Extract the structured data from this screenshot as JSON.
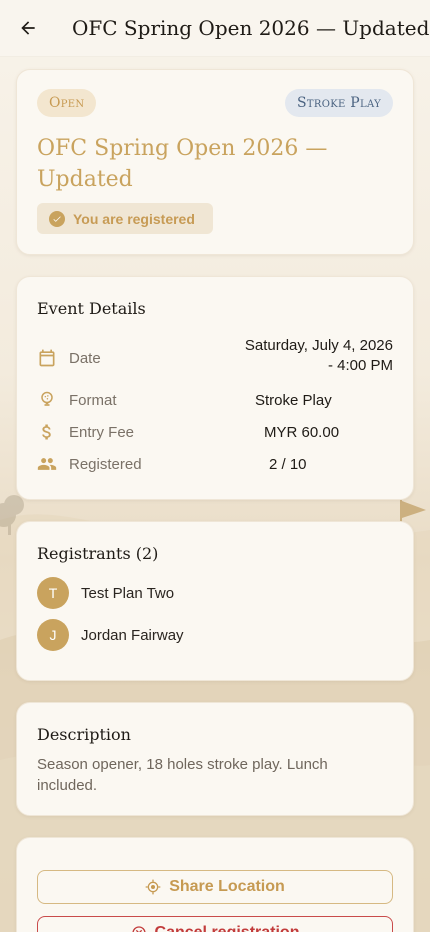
{
  "appbar": {
    "title": "OFC Spring Open 2026 — Updated",
    "back_icon": "arrow-left-icon"
  },
  "hero": {
    "status_chip": "Open",
    "type_chip": "Stroke Play",
    "title": "OFC Spring Open 2026 — Updated",
    "registered_label": "You are registered"
  },
  "details": {
    "heading": "Event Details",
    "rows": [
      {
        "icon": "calendar-icon",
        "label": "Date",
        "value": "Saturday, July 4, 2026 - 4:00 PM"
      },
      {
        "icon": "golf-ball-icon",
        "label": "Format",
        "value": "Stroke Play"
      },
      {
        "icon": "dollar-icon",
        "label": "Entry Fee",
        "value": "MYR 60.00"
      },
      {
        "icon": "people-icon",
        "label": "Registered",
        "value": "2 / 10"
      }
    ]
  },
  "registrants": {
    "heading": "Registrants (2)",
    "items": [
      {
        "initial": "T",
        "name": "Test Plan Two"
      },
      {
        "initial": "J",
        "name": "Jordan Fairway"
      }
    ]
  },
  "description": {
    "heading": "Description",
    "text": "Season opener, 18 holes stroke play. Lunch included."
  },
  "actions": {
    "share_label": "Share Location",
    "cancel_label": "Cancel registration"
  },
  "colors": {
    "accent": "#c9a35e",
    "danger": "#c23b3b",
    "type_chip_text": "#4b6381"
  }
}
